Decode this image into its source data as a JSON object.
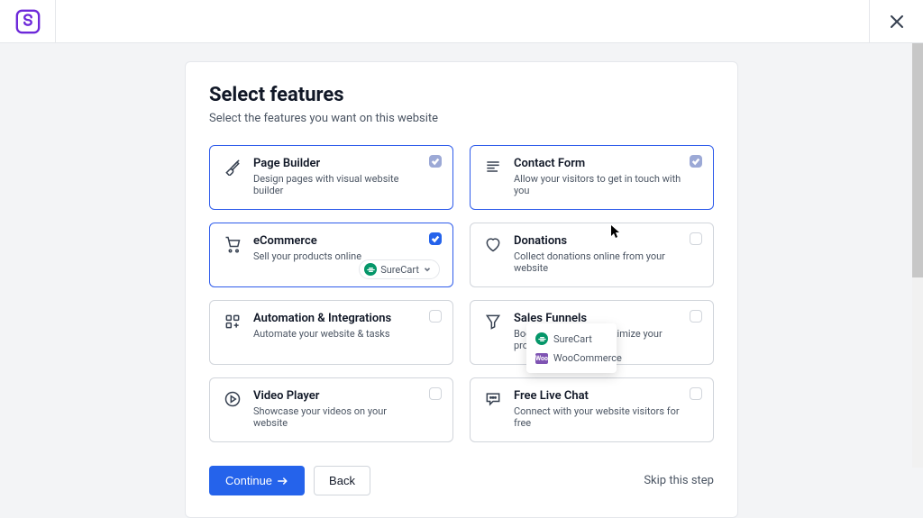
{
  "title": "Select features",
  "subtitle": "Select the features you want on this website",
  "features": [
    {
      "label": "Page Builder",
      "desc": "Design pages with visual website builder"
    },
    {
      "label": "Contact Form",
      "desc": "Allow your visitors to get in touch with you"
    },
    {
      "label": "eCommerce",
      "desc": "Sell your products online"
    },
    {
      "label": "Donations",
      "desc": "Collect donations online from your website"
    },
    {
      "label": "Automation & Integrations",
      "desc": "Automate your website & tasks"
    },
    {
      "label": "Sales Funnels",
      "desc": "Boost your sales & maximize your profits"
    },
    {
      "label": "Video Player",
      "desc": "Showcase your videos on your website"
    },
    {
      "label": "Free Live Chat",
      "desc": "Connect with your website visitors for free"
    }
  ],
  "provider": {
    "selected": "SureCart",
    "options": [
      "SureCart",
      "WooCommerce"
    ]
  },
  "footer": {
    "continue": "Continue",
    "back": "Back",
    "skip": "Skip this step"
  }
}
